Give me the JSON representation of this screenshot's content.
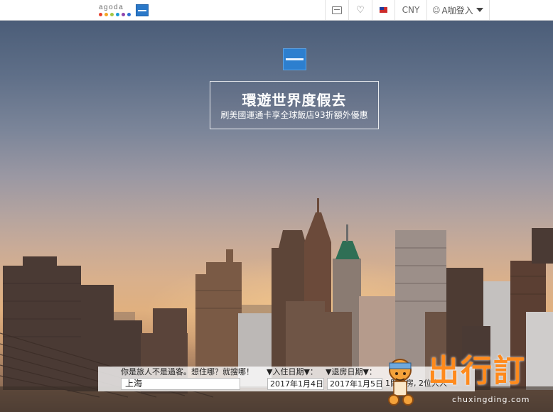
{
  "header": {
    "brand_name": "agoda",
    "brand_dot_colors": [
      "#e8412d",
      "#f5a623",
      "#a3c644",
      "#1a9bd7",
      "#8e44ad",
      "#2b6fd6"
    ],
    "partner_logo": "amex-logo",
    "message_icon": "message-icon",
    "favorites_icon": "heart-icon",
    "language_flag": "taiwan-flag-icon",
    "currency": "CNY",
    "login_label": "A咖登入"
  },
  "hero": {
    "logo": "american-express-logo",
    "promo_title": "環遊世界度假去",
    "promo_subtitle": "刷美國運通卡享全球飯店93折額外優惠",
    "accent_color": "#2d7fcf"
  },
  "search": {
    "question": "你是旅人不是過客。想住哪？就搜哪！",
    "destination_value": "上海",
    "checkin_label": "▼入住日期▼：",
    "checkout_label": "▼退房日期▼：",
    "checkin_value": "2017年1月4日",
    "checkout_value": "2017年1月5日",
    "guests_value": "1間客房, 2位大人"
  },
  "watermark": {
    "text": "出行訂",
    "url": "chuxingding.com",
    "color": "#ff8a1c"
  }
}
